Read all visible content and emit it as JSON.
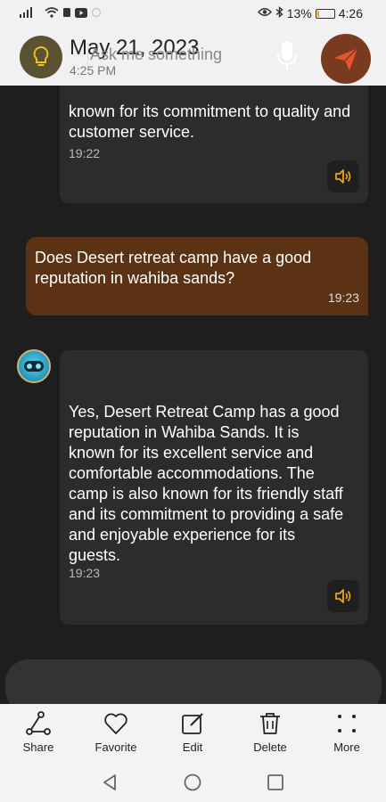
{
  "status": {
    "battery": "13%",
    "time": "4:26",
    "battery_level": 0.13
  },
  "header": {
    "title": "May 21, 2023",
    "subtitle": "4:25 PM"
  },
  "messages": [
    {
      "role": "ai",
      "text": "known for its commitment to quality and customer service.",
      "time": "19:22"
    },
    {
      "role": "user",
      "text": "Does Desert retreat camp have a good reputation in wahiba sands?",
      "time": "19:23"
    },
    {
      "role": "ai",
      "text": "Yes, Desert Retreat Camp has a good reputation in Wahiba Sands. It is known for its excellent service and comfortable accommodations. The camp is also known for its friendly staff and its commitment to providing a safe and enjoyable experience for its guests.",
      "time": "19:23"
    }
  ],
  "input": {
    "placeholder": "Ask me something"
  },
  "toolbar": {
    "share": "Share",
    "favorite": "Favorite",
    "edit": "Edit",
    "delete": "Delete",
    "more": "More"
  },
  "colors": {
    "user_bubble": "#5b3214",
    "ai_bubble": "#2c2c2c",
    "accent": "#f0a11a",
    "send": "#e8552a"
  }
}
